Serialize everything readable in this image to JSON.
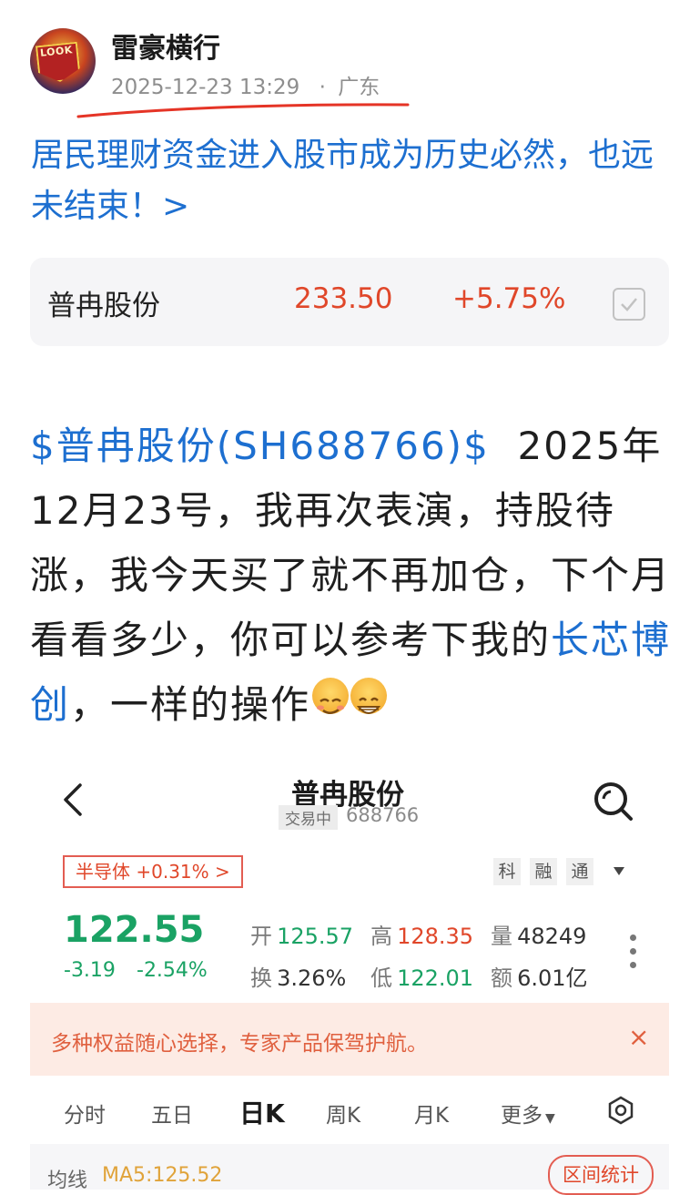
{
  "post": {
    "author": "雷豪横行",
    "avatar_text": "LOOK",
    "timestamp": "2025-12-23 13:29",
    "location_sep": "·",
    "location": "广东",
    "headline": "居民理财资金进入股市成为历史必然，也远未结束！>",
    "stock_card": {
      "name": "普冉股份",
      "price": "233.50",
      "change_pct": "+5.75%"
    },
    "body": {
      "stock_link": "$普冉股份(SH688766)$",
      "text_1": "  2025年12月23号，我再次表演，持股待涨，我今天买了就不再加仓，下个月看看多少，你可以参考下我的",
      "inline_link": "长芯博创",
      "text_2": "，一样的操作"
    }
  },
  "quote_screen": {
    "title": "普冉股份",
    "status_tag": "交易中",
    "code": "688766",
    "sector_tag": "半导体 +0.31% >",
    "badges": [
      "科",
      "融",
      "通"
    ],
    "price": "122.55",
    "change": "-3.19",
    "change_pct": "-2.54%",
    "stats": {
      "open_label": "开",
      "open": "125.57",
      "high_label": "高",
      "high": "128.35",
      "volume_label": "量",
      "volume": "48249",
      "turnover_label": "换",
      "turnover": "3.26%",
      "low_label": "低",
      "low": "122.01",
      "amount_label": "额",
      "amount": "6.01亿"
    },
    "banner": {
      "text": "多种权益随心选择，专家产品保驾护航。",
      "close": "×"
    },
    "tabs": [
      "分时",
      "五日",
      "日K",
      "周K",
      "月K",
      "更多"
    ],
    "active_tab": "日K",
    "ma": {
      "label": "均线",
      "value": "MA5:125.52"
    },
    "range_button": "区间统计"
  },
  "colors": {
    "link": "#1d6fd0",
    "up": "#e0472a",
    "down": "#1aa264",
    "banner_bg": "#fdebe4"
  }
}
